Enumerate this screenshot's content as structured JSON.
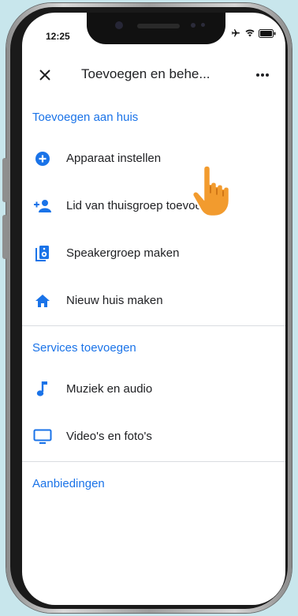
{
  "status_bar": {
    "time": "12:25"
  },
  "app_bar": {
    "title": "Toevoegen en behe..."
  },
  "sections": {
    "add_to_home": {
      "header": "Toevoegen aan huis",
      "items": [
        {
          "label": "Apparaat instellen",
          "icon": "add-circle-icon"
        },
        {
          "label": "Lid van thuisgroep toevoegen",
          "icon": "add-person-icon"
        },
        {
          "label": "Speakergroep maken",
          "icon": "speaker-group-icon"
        },
        {
          "label": "Nieuw huis maken",
          "icon": "home-icon"
        }
      ]
    },
    "services": {
      "header": "Services toevoegen",
      "items": [
        {
          "label": "Muziek en audio",
          "icon": "music-note-icon"
        },
        {
          "label": "Video's en foto's",
          "icon": "tv-icon"
        }
      ]
    },
    "offers": {
      "header": "Aanbiedingen"
    }
  },
  "colors": {
    "accent": "#1a73e8",
    "icon": "#1a73e8",
    "text": "#202124",
    "divider": "#dadce0",
    "hand": "#f29b2e"
  }
}
